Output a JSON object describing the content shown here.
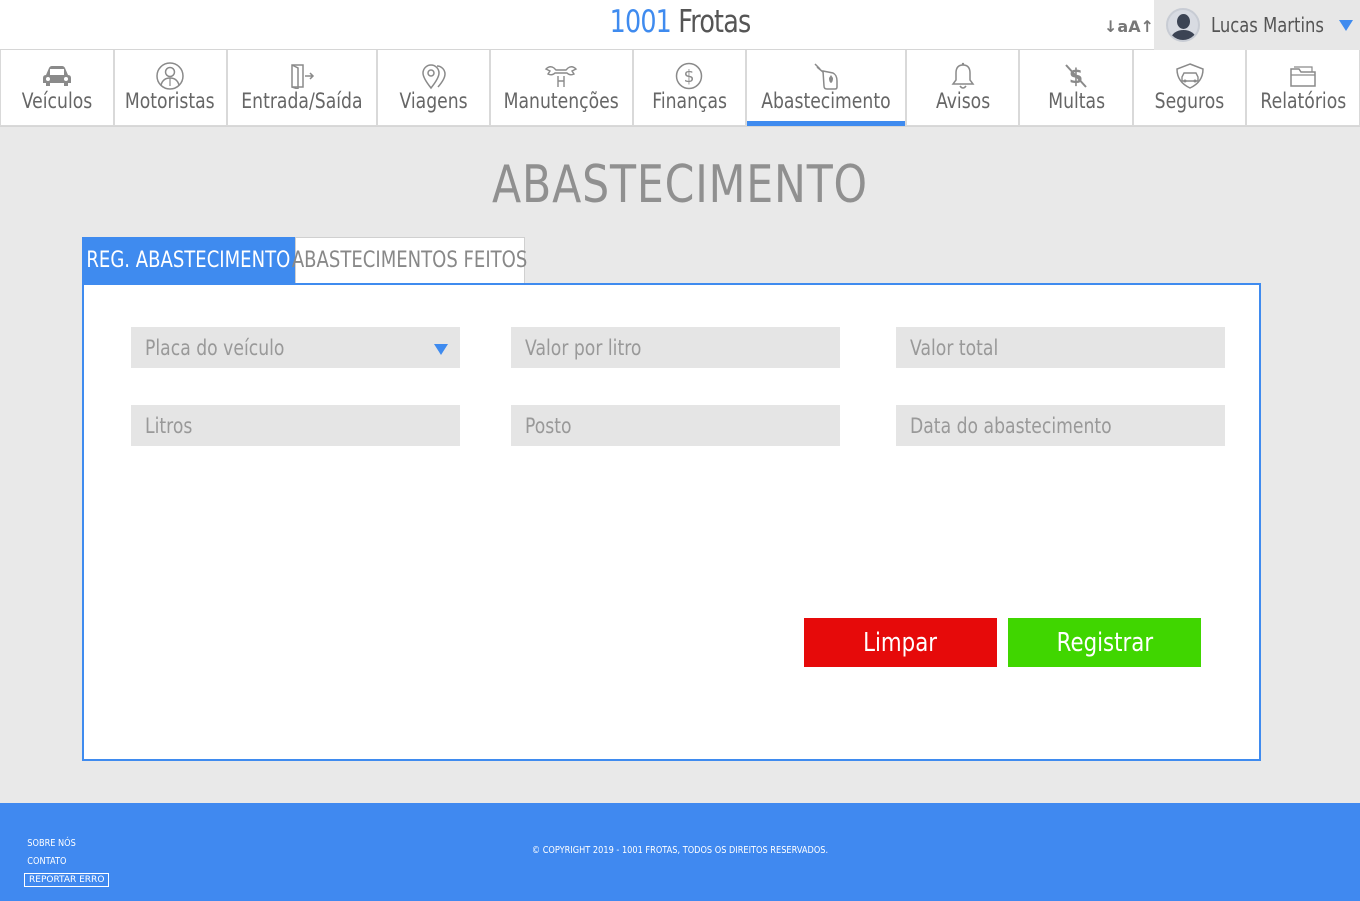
{
  "header": {
    "brand_num": "1001",
    "brand_text": " Frotas",
    "font_toggle": "↓aA↑",
    "user_name": "Lucas Martins"
  },
  "nav": [
    {
      "label": "Veículos",
      "icon": "car-icon",
      "active": false
    },
    {
      "label": "Motoristas",
      "icon": "driver-icon",
      "active": false
    },
    {
      "label": "Entrada/Saída",
      "icon": "door-icon",
      "active": false
    },
    {
      "label": "Viagens",
      "icon": "map-pin-icon",
      "active": false
    },
    {
      "label": "Manutenções",
      "icon": "wrench-icon",
      "active": false
    },
    {
      "label": "Finanças",
      "icon": "dollar-icon",
      "active": false
    },
    {
      "label": "Abastecimento",
      "icon": "fuel-pump-icon",
      "active": true
    },
    {
      "label": "Avisos",
      "icon": "bell-icon",
      "active": false
    },
    {
      "label": "Multas",
      "icon": "fine-icon",
      "active": false
    },
    {
      "label": "Seguros",
      "icon": "insurance-icon",
      "active": false
    },
    {
      "label": "Relatórios",
      "icon": "folder-icon",
      "active": false
    }
  ],
  "page_title": "ABASTECIMENTO",
  "tabs": {
    "register": "REG. ABASTECIMENTO",
    "history": "ABASTECIMENTOS FEITOS"
  },
  "form": {
    "plate": "Placa do veículo",
    "price_per_liter": "Valor por litro",
    "total": "Valor total",
    "liters": "Litros",
    "station": "Posto",
    "date": "Data do abastecimento"
  },
  "buttons": {
    "clear": "Limpar",
    "register": "Registrar"
  },
  "footer": {
    "about": "SOBRE NÓS",
    "contact": "CONTATO",
    "report": "REPORTAR ERRO",
    "copyright": "© COPYRIGHT 2019 - 1001 FROTAS, TODOS OS DIREITOS RESERVADOS."
  },
  "colors": {
    "accent": "#3f8bef",
    "clear": "#e60a0a",
    "register": "#40d600",
    "footer": "#4089f0"
  }
}
